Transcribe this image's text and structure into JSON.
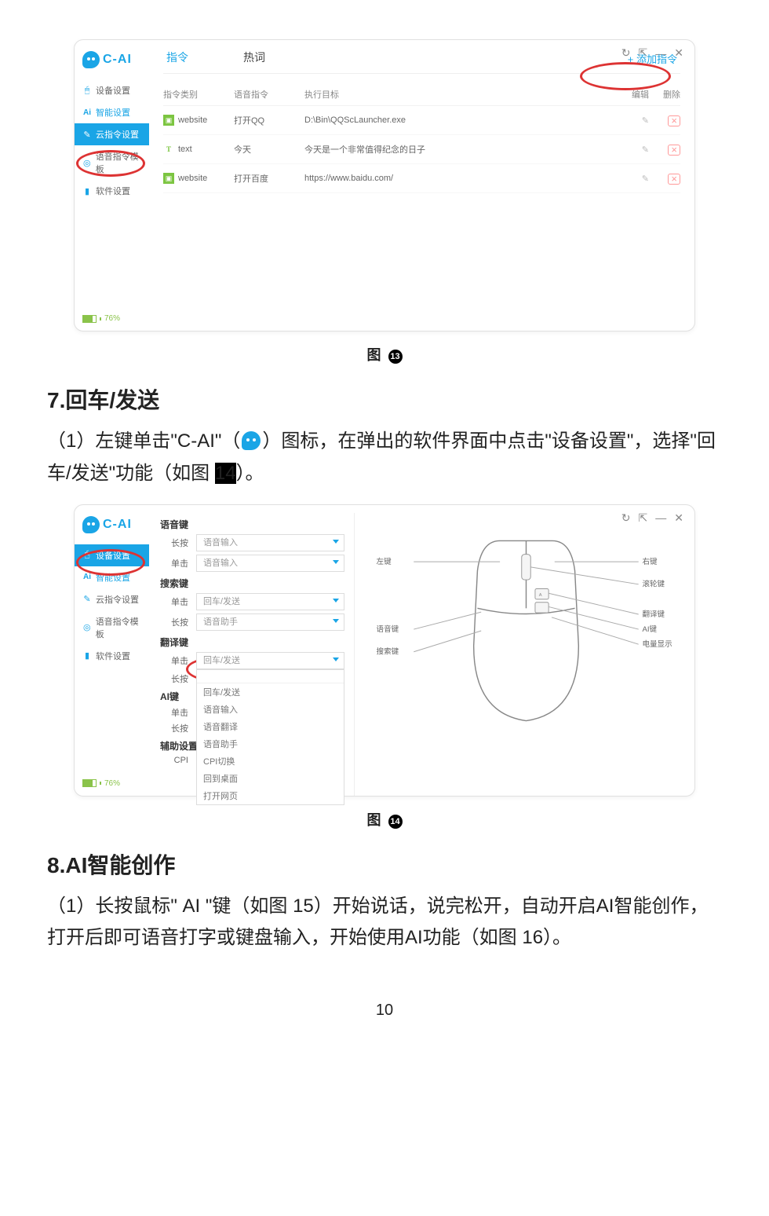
{
  "fig13": {
    "logo": "C-AI",
    "sidebar": [
      {
        "icon": "mouse",
        "label": "设备设置",
        "color": "blue"
      },
      {
        "icon": "ai",
        "label": "智能设置",
        "prefix": "Ai",
        "color": "blue"
      },
      {
        "icon": "cloud",
        "label": "云指令设置",
        "active": true
      },
      {
        "icon": "target",
        "label": "语音指令模板",
        "color": "teal"
      },
      {
        "icon": "bookmark",
        "label": "软件设置",
        "color": "blue"
      }
    ],
    "battery": "76%",
    "tabs": {
      "t1": "指令",
      "t2": "热词"
    },
    "add": "+ 添加指令",
    "columns": {
      "c1": "指令类别",
      "c2": "语音指令",
      "c3": "执行目标",
      "c4": "编辑",
      "c5": "删除"
    },
    "rows": [
      {
        "badge": "website",
        "type": "web",
        "voice": "打开QQ",
        "target": "D:\\Bin\\QQScLauncher.exe"
      },
      {
        "badge": "text",
        "type": "text",
        "voice": "今天",
        "target": "今天是一个非常值得纪念的日子"
      },
      {
        "badge": "website",
        "type": "web",
        "voice": "打开百度",
        "target": "https://www.baidu.com/"
      }
    ]
  },
  "captions": {
    "fig13_label": "图",
    "fig13_num": "13",
    "fig14_label": "图",
    "fig14_num": "14"
  },
  "section7": {
    "heading": "7.回车/发送",
    "body_pre": "（1）左键单击\"C-AI\"（",
    "body_post": "）图标，在弹出的软件界面中点击\"设备设置\"，选择\"回车/发送\"功能（如图 ",
    "body_end": "）。"
  },
  "fig14": {
    "logo": "C-AI",
    "sidebar": [
      {
        "icon": "mouse",
        "label": "设备设置",
        "active": true
      },
      {
        "icon": "ai",
        "label": "智能设置",
        "prefix": "Ai"
      },
      {
        "icon": "cloud",
        "label": "云指令设置"
      },
      {
        "icon": "target",
        "label": "语音指令模板"
      },
      {
        "icon": "bookmark",
        "label": "软件设置"
      }
    ],
    "battery": "76%",
    "sections": {
      "voice_key": "语音键",
      "search_key": "搜索键",
      "translate_key": "翻译键",
      "ai_key": "AI键",
      "aux": "辅助设置"
    },
    "labels": {
      "long": "长按",
      "click": "单击",
      "cpi": "CPI"
    },
    "values": {
      "voice_long": "语音输入",
      "voice_click": "语音输入",
      "search_click": "回车/发送",
      "search_long": "语音助手",
      "translate_click": "回车/发送",
      "translate_long": ""
    },
    "dropdown": [
      "回车/发送",
      "语音输入",
      "语音翻译",
      "语音助手",
      "CPI切换",
      "回到桌面",
      "打开网页"
    ],
    "dropdown_hint": "",
    "mouse_labels": {
      "left": "左键",
      "right": "右键",
      "wheel": "滚轮键",
      "translate": "翻译键",
      "voice": "语音键",
      "ai": "AI键",
      "search": "搜索键",
      "battery": "电量显示"
    }
  },
  "section8": {
    "heading": "8.AI智能创作",
    "body1_a": "（1）长按鼠标\" AI \"键（如图 ",
    "body1_b": "）开始说话，说完松开，自动开启AI智能创作，打开后即可语音打字或键盘输入，开始使用AI功能（如图 ",
    "body1_c": "）。",
    "ref15": "15",
    "ref16": "16"
  },
  "page_number": "10"
}
